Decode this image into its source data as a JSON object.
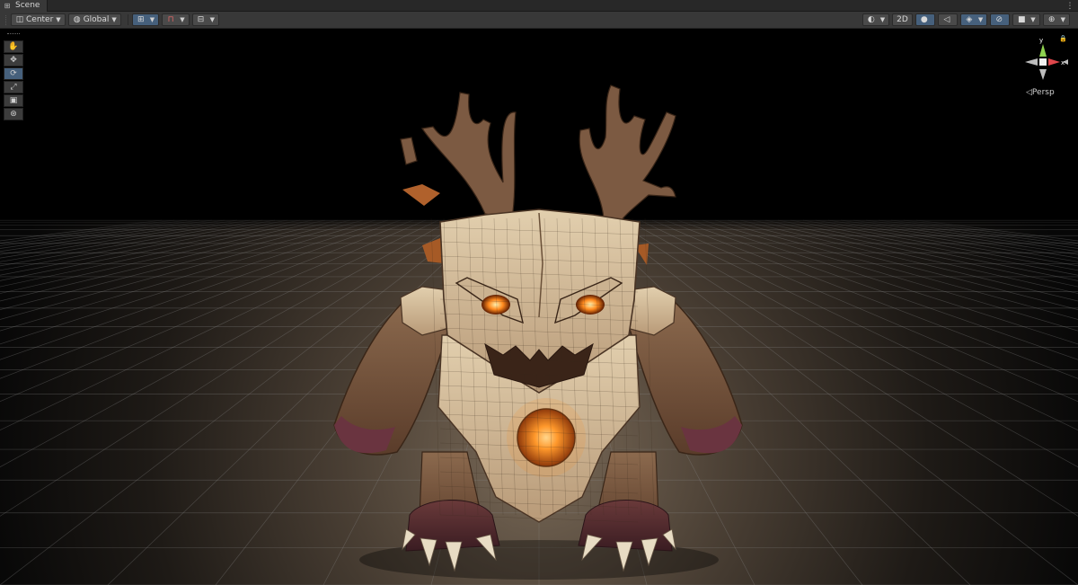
{
  "window": {
    "tab_title": "Scene",
    "tab_icon": "scene-icon",
    "menu_icon": "kebab-menu-icon"
  },
  "toolbar": {
    "pivot_mode": "Center",
    "pivot_rotation": "Global",
    "draw_mode": "2D"
  },
  "tools": [
    {
      "name": "hand-tool",
      "icon": "hand-icon",
      "glyph": "✋",
      "active": false
    },
    {
      "name": "move-tool",
      "icon": "move-icon",
      "glyph": "✥",
      "active": false
    },
    {
      "name": "rotate-tool",
      "icon": "rotate-icon",
      "glyph": "⟳",
      "active": true
    },
    {
      "name": "scale-tool",
      "icon": "scale-icon",
      "glyph": "⤢",
      "active": false
    },
    {
      "name": "rect-tool",
      "icon": "rect-icon",
      "glyph": "▣",
      "active": false
    },
    {
      "name": "transform-tool",
      "icon": "transform-icon",
      "glyph": "⊛",
      "active": false
    }
  ],
  "gizmo": {
    "y_label": "y",
    "x_label": "x",
    "projection": "Persp"
  },
  "colors": {
    "accent": "#46607c",
    "axis_y": "#8fd14f",
    "axis_x": "#e0474c",
    "panel": "#383838"
  }
}
